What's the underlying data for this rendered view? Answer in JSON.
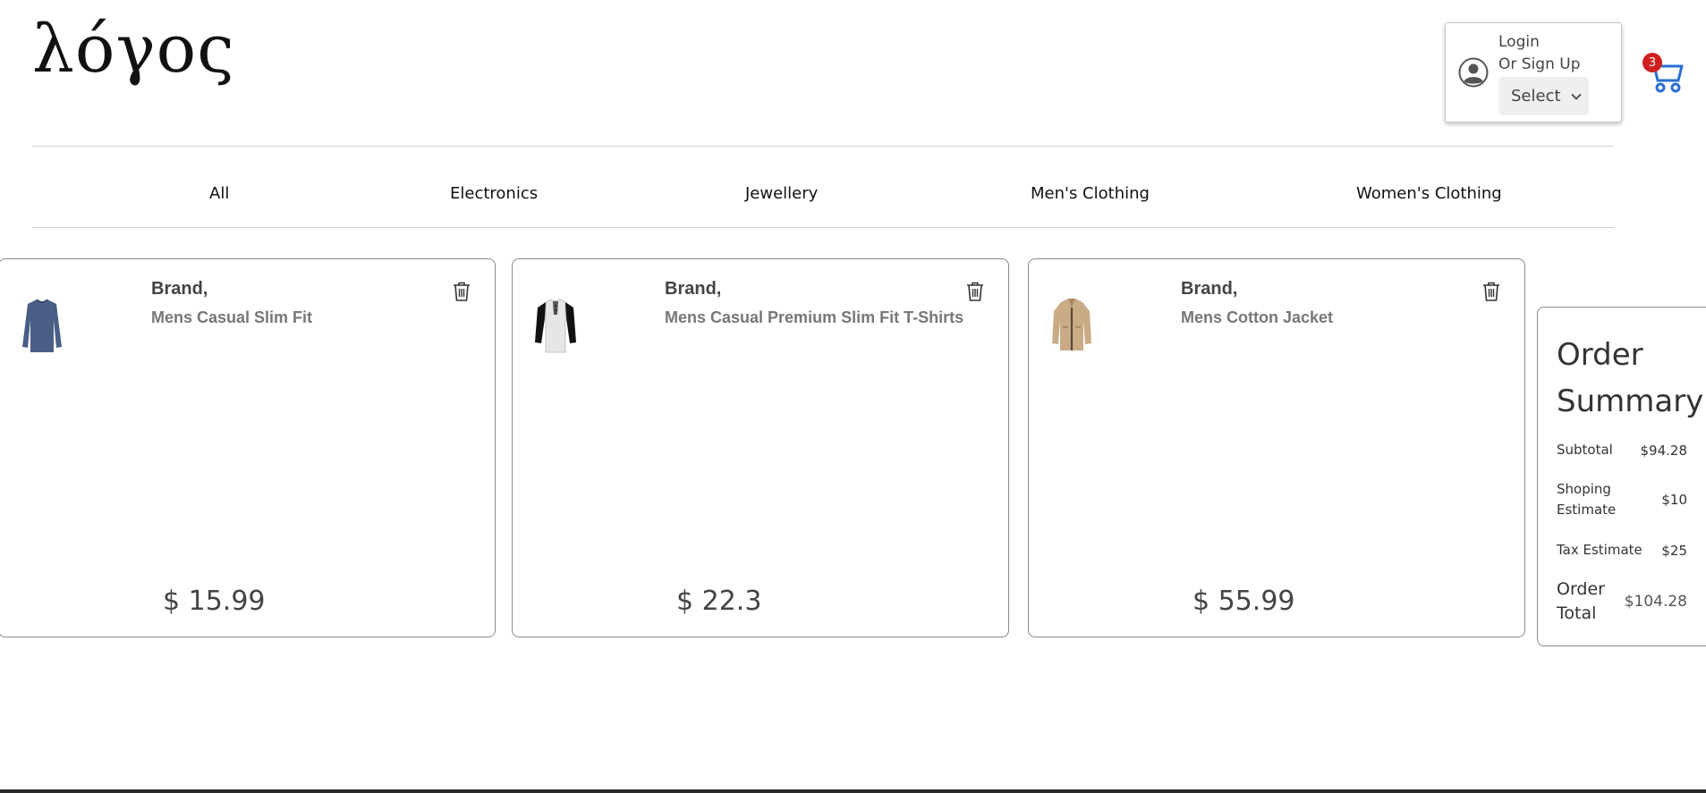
{
  "header": {
    "logo": "λόγος",
    "account": {
      "login": "Login",
      "signup": "Or Sign Up",
      "select_label": "Select"
    },
    "cart": {
      "count": "3",
      "accent": "#2a6fd6",
      "badge_color": "#d11f1f"
    }
  },
  "categories": [
    "All",
    "Electronics",
    "Jewellery",
    "Men's Clothing",
    "Women's Clothing"
  ],
  "cart_items": [
    {
      "brand": "Brand,",
      "title": "Mens Casual Slim Fit",
      "price": "$ 15.99",
      "image_icon": "blue-long-sleeve-shirt"
    },
    {
      "brand": "Brand,",
      "title": "Mens Casual Premium Slim Fit T-Shirts",
      "price": "$ 22.3",
      "image_icon": "raglan-henley-shirt"
    },
    {
      "brand": "Brand,",
      "title": "Mens Cotton Jacket",
      "price": "$ 55.99",
      "image_icon": "tan-cotton-jacket"
    }
  ],
  "summary": {
    "heading": "Order Summary",
    "subtotal_label": "Subtotal",
    "subtotal_value": "$94.28",
    "shipping_label": "Shoping Estimate",
    "shipping_value": "$10",
    "tax_label": "Tax Estimate",
    "tax_value": "$25",
    "total_label": "Order Total",
    "total_value": "$104.28"
  }
}
